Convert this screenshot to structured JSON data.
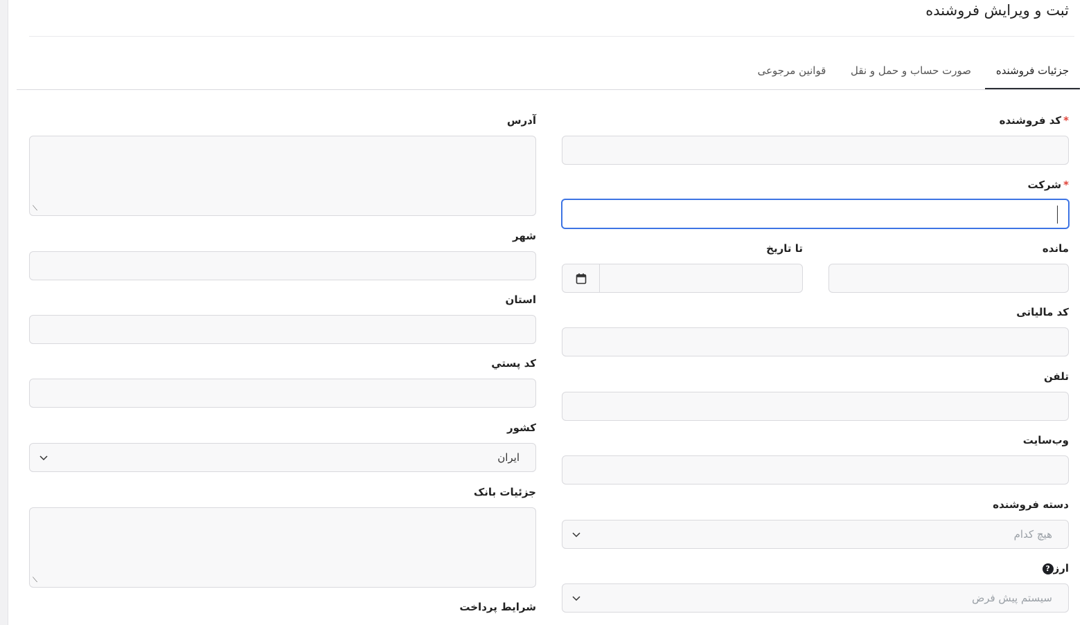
{
  "page": {
    "title": "ثبت و ویرایش فروشنده"
  },
  "tabs": [
    {
      "label": "جزئیات فروشنده",
      "active": true
    },
    {
      "label": "صورت حساب و حمل و نقل",
      "active": false
    },
    {
      "label": "قوانین مرجوعی",
      "active": false
    }
  ],
  "form_right": {
    "vendor_code": {
      "label": "کد فروشنده",
      "required_mark": "*",
      "value": ""
    },
    "company": {
      "label": "شرکت",
      "required_mark": "*",
      "value": ""
    },
    "balance": {
      "label": "مانده",
      "value": ""
    },
    "to_date": {
      "label": "تا تاریخ",
      "value": ""
    },
    "tax_code": {
      "label": "کد مالیاتی",
      "value": ""
    },
    "phone": {
      "label": "تلفن",
      "value": ""
    },
    "website": {
      "label": "وب‌سایت",
      "value": ""
    },
    "vendor_category": {
      "label": "دسته فروشنده",
      "placeholder": "هیچ کدام"
    },
    "currency": {
      "label": "ارز",
      "help_icon": "?",
      "placeholder": "سیستم پیش فرض"
    }
  },
  "form_left": {
    "address": {
      "label": "آدرس",
      "value": ""
    },
    "city": {
      "label": "شهر",
      "value": ""
    },
    "province": {
      "label": "استان",
      "value": ""
    },
    "postal_code": {
      "label": "کد پستي",
      "value": ""
    },
    "country": {
      "label": "کشور",
      "value": "ایران"
    },
    "bank_details": {
      "label": "جزئیات بانک",
      "value": ""
    },
    "payment_terms": {
      "label": "شرایط پرداخت"
    }
  },
  "icons": {
    "calendar": "calendar-icon",
    "chevron": "chevron-down-icon",
    "help": "question-circle-icon",
    "resize": "resize-grip-icon"
  },
  "colors": {
    "focus_border": "#3d74e4",
    "required": "#e0443a",
    "input_bg": "#f8f8f9",
    "tab_indicator": "#2b2f36"
  }
}
